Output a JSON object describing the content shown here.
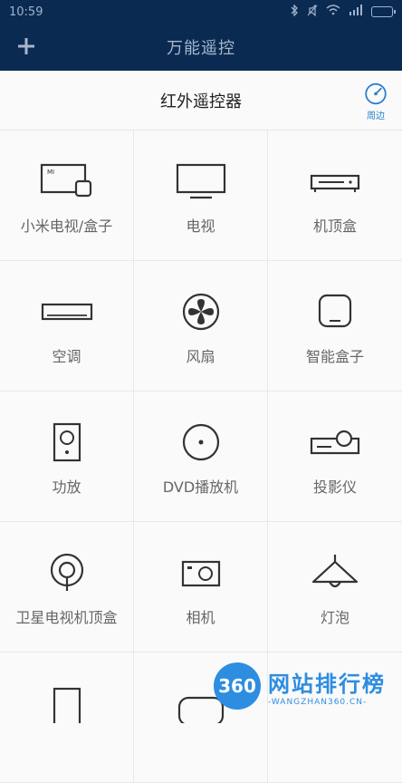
{
  "status_bar": {
    "time": "10:59"
  },
  "app_bar": {
    "title": "万能遥控"
  },
  "subheader": {
    "title": "红外遥控器",
    "nearby_label": "周边"
  },
  "devices": [
    {
      "label": "小米电视/盒子",
      "icon": "mi-tv-box-icon"
    },
    {
      "label": "电视",
      "icon": "tv-icon"
    },
    {
      "label": "机顶盒",
      "icon": "set-top-box-icon"
    },
    {
      "label": "空调",
      "icon": "air-conditioner-icon"
    },
    {
      "label": "风扇",
      "icon": "fan-icon"
    },
    {
      "label": "智能盒子",
      "icon": "smart-box-icon"
    },
    {
      "label": "功放",
      "icon": "amplifier-icon"
    },
    {
      "label": "DVD播放机",
      "icon": "dvd-icon"
    },
    {
      "label": "投影仪",
      "icon": "projector-icon"
    },
    {
      "label": "卫星电视机顶盒",
      "icon": "satellite-icon"
    },
    {
      "label": "相机",
      "icon": "camera-icon"
    },
    {
      "label": "灯泡",
      "icon": "lamp-icon"
    },
    {
      "label": "",
      "icon": "partial-device-icon"
    },
    {
      "label": "",
      "icon": "partial-device-icon"
    },
    {
      "label": "",
      "icon": ""
    }
  ],
  "watermark": {
    "badge": "360",
    "main": "网站排行榜",
    "sub": "-WANGZHAN360.CN-"
  },
  "colors": {
    "header": "#0a2a52",
    "accent": "#2a7fcf",
    "icon": "#333333",
    "label": "#666666"
  }
}
